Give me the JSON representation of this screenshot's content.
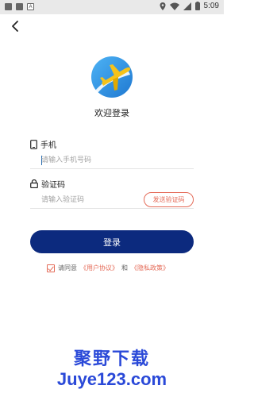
{
  "status_bar": {
    "time": "5:09",
    "left_icons": [
      "square-icon",
      "photo-icon",
      "a-icon"
    ],
    "right_icons": [
      "location-icon",
      "wifi-icon",
      "signal-icon",
      "battery-icon"
    ],
    "a_letter": "A"
  },
  "header": {
    "back_icon": "chevron-left-icon"
  },
  "page": {
    "title": "欢迎登录"
  },
  "form": {
    "phone_label": "手机",
    "phone_placeholder": "请输入手机号码",
    "code_label": "验证码",
    "code_placeholder": "请输入验证码",
    "send_code_label": "发送验证码",
    "login_label": "登录"
  },
  "agreement": {
    "prefix": "请同意",
    "user_agreement": "《用户协议》",
    "and": "和",
    "privacy_policy": "《隐私政策》",
    "checked": true
  },
  "watermark": {
    "cn": "聚野下载",
    "en": "Juye123.com"
  },
  "colors": {
    "primary": "#0c2a7e",
    "accent": "#e46a57",
    "watermark": "#2a49d8",
    "logo_blue": "#2b8fe0",
    "logo_yellow": "#f5c21b"
  }
}
